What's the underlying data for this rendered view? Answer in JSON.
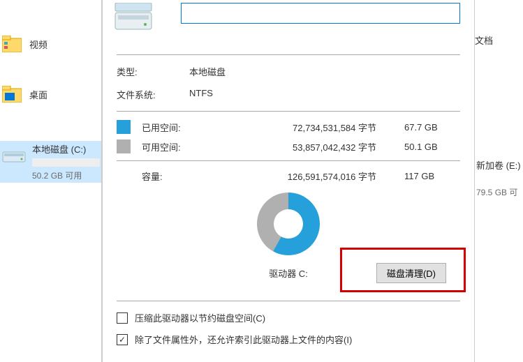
{
  "left": {
    "nav1": "视频",
    "nav2": "桌面",
    "drive": {
      "label": "本地磁盘 (C:)",
      "free": "50.2 GB 可用"
    }
  },
  "right": {
    "nav1": "文档",
    "drive": {
      "label": "新加卷 (E:)",
      "free": "79.5 GB 可"
    }
  },
  "props": {
    "type_key": "类型:",
    "type_val": "本地磁盘",
    "fs_key": "文件系统:",
    "fs_val": "NTFS",
    "used_label": "已用空间:",
    "used_bytes": "72,734,531,584 字节",
    "used_gb": "67.7 GB",
    "free_label": "可用空间:",
    "free_bytes": "53,857,042,432 字节",
    "free_gb": "50.1 GB",
    "cap_label": "容量:",
    "cap_bytes": "126,591,574,016 字节",
    "cap_gb": "117 GB",
    "drive_letter": "驱动器 C:",
    "cleanup_btn": "磁盘清理(D)",
    "compress_label": "压缩此驱动器以节约磁盘空间(C)",
    "index_label": "除了文件属性外，还允许索引此驱动器上文件的内容(I)"
  },
  "chart_data": {
    "type": "pie",
    "title": "驱动器 C:",
    "series": [
      {
        "name": "已用空间",
        "value": 67.7,
        "color": "#26a0da"
      },
      {
        "name": "可用空间",
        "value": 50.1,
        "color": "#b0b0b0"
      }
    ],
    "total": 117,
    "unit": "GB"
  }
}
